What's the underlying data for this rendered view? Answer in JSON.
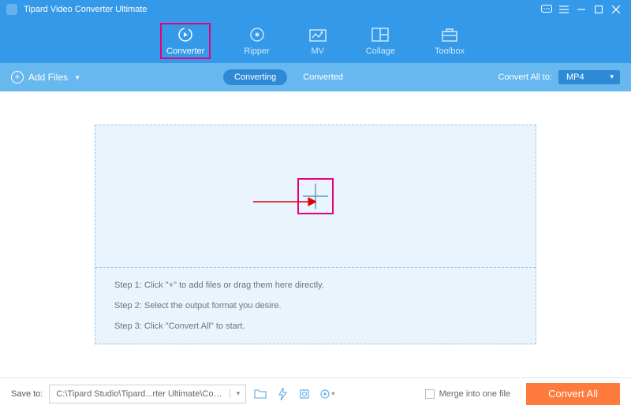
{
  "app": {
    "title": "Tipard Video Converter Ultimate"
  },
  "tabs": {
    "converter": "Converter",
    "ripper": "Ripper",
    "mv": "MV",
    "collage": "Collage",
    "toolbox": "Toolbox"
  },
  "subbar": {
    "add_files": "Add Files",
    "converting": "Converting",
    "converted": "Converted",
    "convert_all_to": "Convert All to:",
    "format": "MP4"
  },
  "steps": {
    "s1": "Step 1: Click \"+\" to add files or drag them here directly.",
    "s2": "Step 2: Select the output format you desire.",
    "s3": "Step 3: Click \"Convert All\" to start."
  },
  "footer": {
    "save_to": "Save to:",
    "path": "C:\\Tipard Studio\\Tipard...rter Ultimate\\Converted",
    "merge": "Merge into one file",
    "convert_all": "Convert All"
  }
}
